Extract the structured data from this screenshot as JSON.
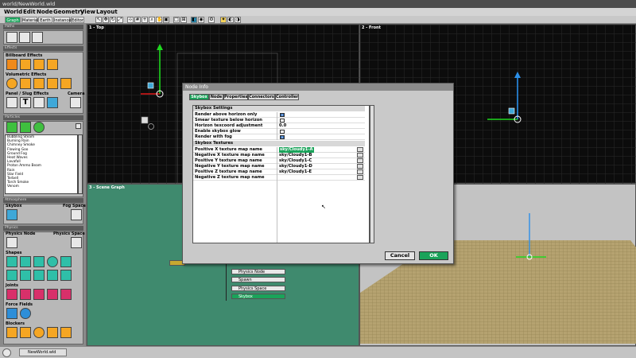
{
  "window": {
    "title": "world/NewWorld.wld"
  },
  "menu": [
    "World",
    "Edit",
    "Node",
    "Geometry",
    "View",
    "Layout"
  ],
  "toolbar_tabs": [
    "Graph",
    "Material",
    "Earth",
    "Instance",
    "Editor"
  ],
  "left_panel": {
    "sections": {
      "paths": "Paths",
      "effects": "Effects",
      "particles": "Particles",
      "atmosphere": "Atmosphere",
      "physics": "Physics"
    },
    "billboard_effects": "Billboard Effects",
    "volumetric_effects": "Volumetric Effects",
    "panel_slug_effects": "Panel / Slug Effects",
    "camera": "Camera",
    "particle_list": [
      "Bubbling Steam",
      "Burning Rain",
      "Chimney Smoke",
      "Flowing Goo",
      "Ground Fog",
      "Heat Waves",
      "Lavafall",
      "Proton Ammo Beam",
      "Rain",
      "Star Field",
      "Terbell",
      "Torch Smoke",
      "Venom"
    ],
    "skybox": "Skybox",
    "fog_space": "Fog Space",
    "physics_node": "Physics Node",
    "physics_space": "Physics Space",
    "shapes": "Shapes",
    "joints": "Joints",
    "force_fields": "Force Fields",
    "blockers": "Blockers"
  },
  "viewports": {
    "top": "1 - Top",
    "front": "2 - Front",
    "scene_graph": "3 - Scene Graph"
  },
  "scene_graph_nodes": [
    "Physics Node",
    "Spawn",
    "Physics Space",
    "Skybox"
  ],
  "dialog": {
    "title": "Node Info",
    "tabs": [
      "Skybox",
      "Node",
      "Properties",
      "Connectors",
      "Controller"
    ],
    "settings_header": "Skybox Settings",
    "settings": [
      {
        "name": "Render above horizon only",
        "type": "check",
        "value": true
      },
      {
        "name": "Smear texture below horizon",
        "type": "check",
        "value": false
      },
      {
        "name": "Horizon texcoord adjustment",
        "type": "text",
        "value": "0.0"
      },
      {
        "name": "Enable skybox glow",
        "type": "check",
        "value": false
      },
      {
        "name": "Render with fog",
        "type": "check",
        "value": true
      }
    ],
    "textures_header": "Skybox Textures",
    "textures": [
      {
        "name": "Positive X texture map name",
        "value": "sky/Cloudy1-A"
      },
      {
        "name": "Negative X texture map name",
        "value": "sky/Cloudy1-B"
      },
      {
        "name": "Positive Y texture map name",
        "value": "sky/Cloudy1-C"
      },
      {
        "name": "Negative Y texture map name",
        "value": "sky/Cloudy1-D"
      },
      {
        "name": "Positive Z texture map name",
        "value": "sky/Cloudy1-E"
      },
      {
        "name": "Negative Z texture map name",
        "value": ""
      }
    ],
    "cancel_label": "Cancel",
    "ok_label": "OK"
  },
  "statusbar": {
    "tab": "NewWorld.wld"
  },
  "colors": {
    "accent": "#1aa35a",
    "grid_bg": "#0c0c0c",
    "scene_bg": "#3f8a6e"
  }
}
